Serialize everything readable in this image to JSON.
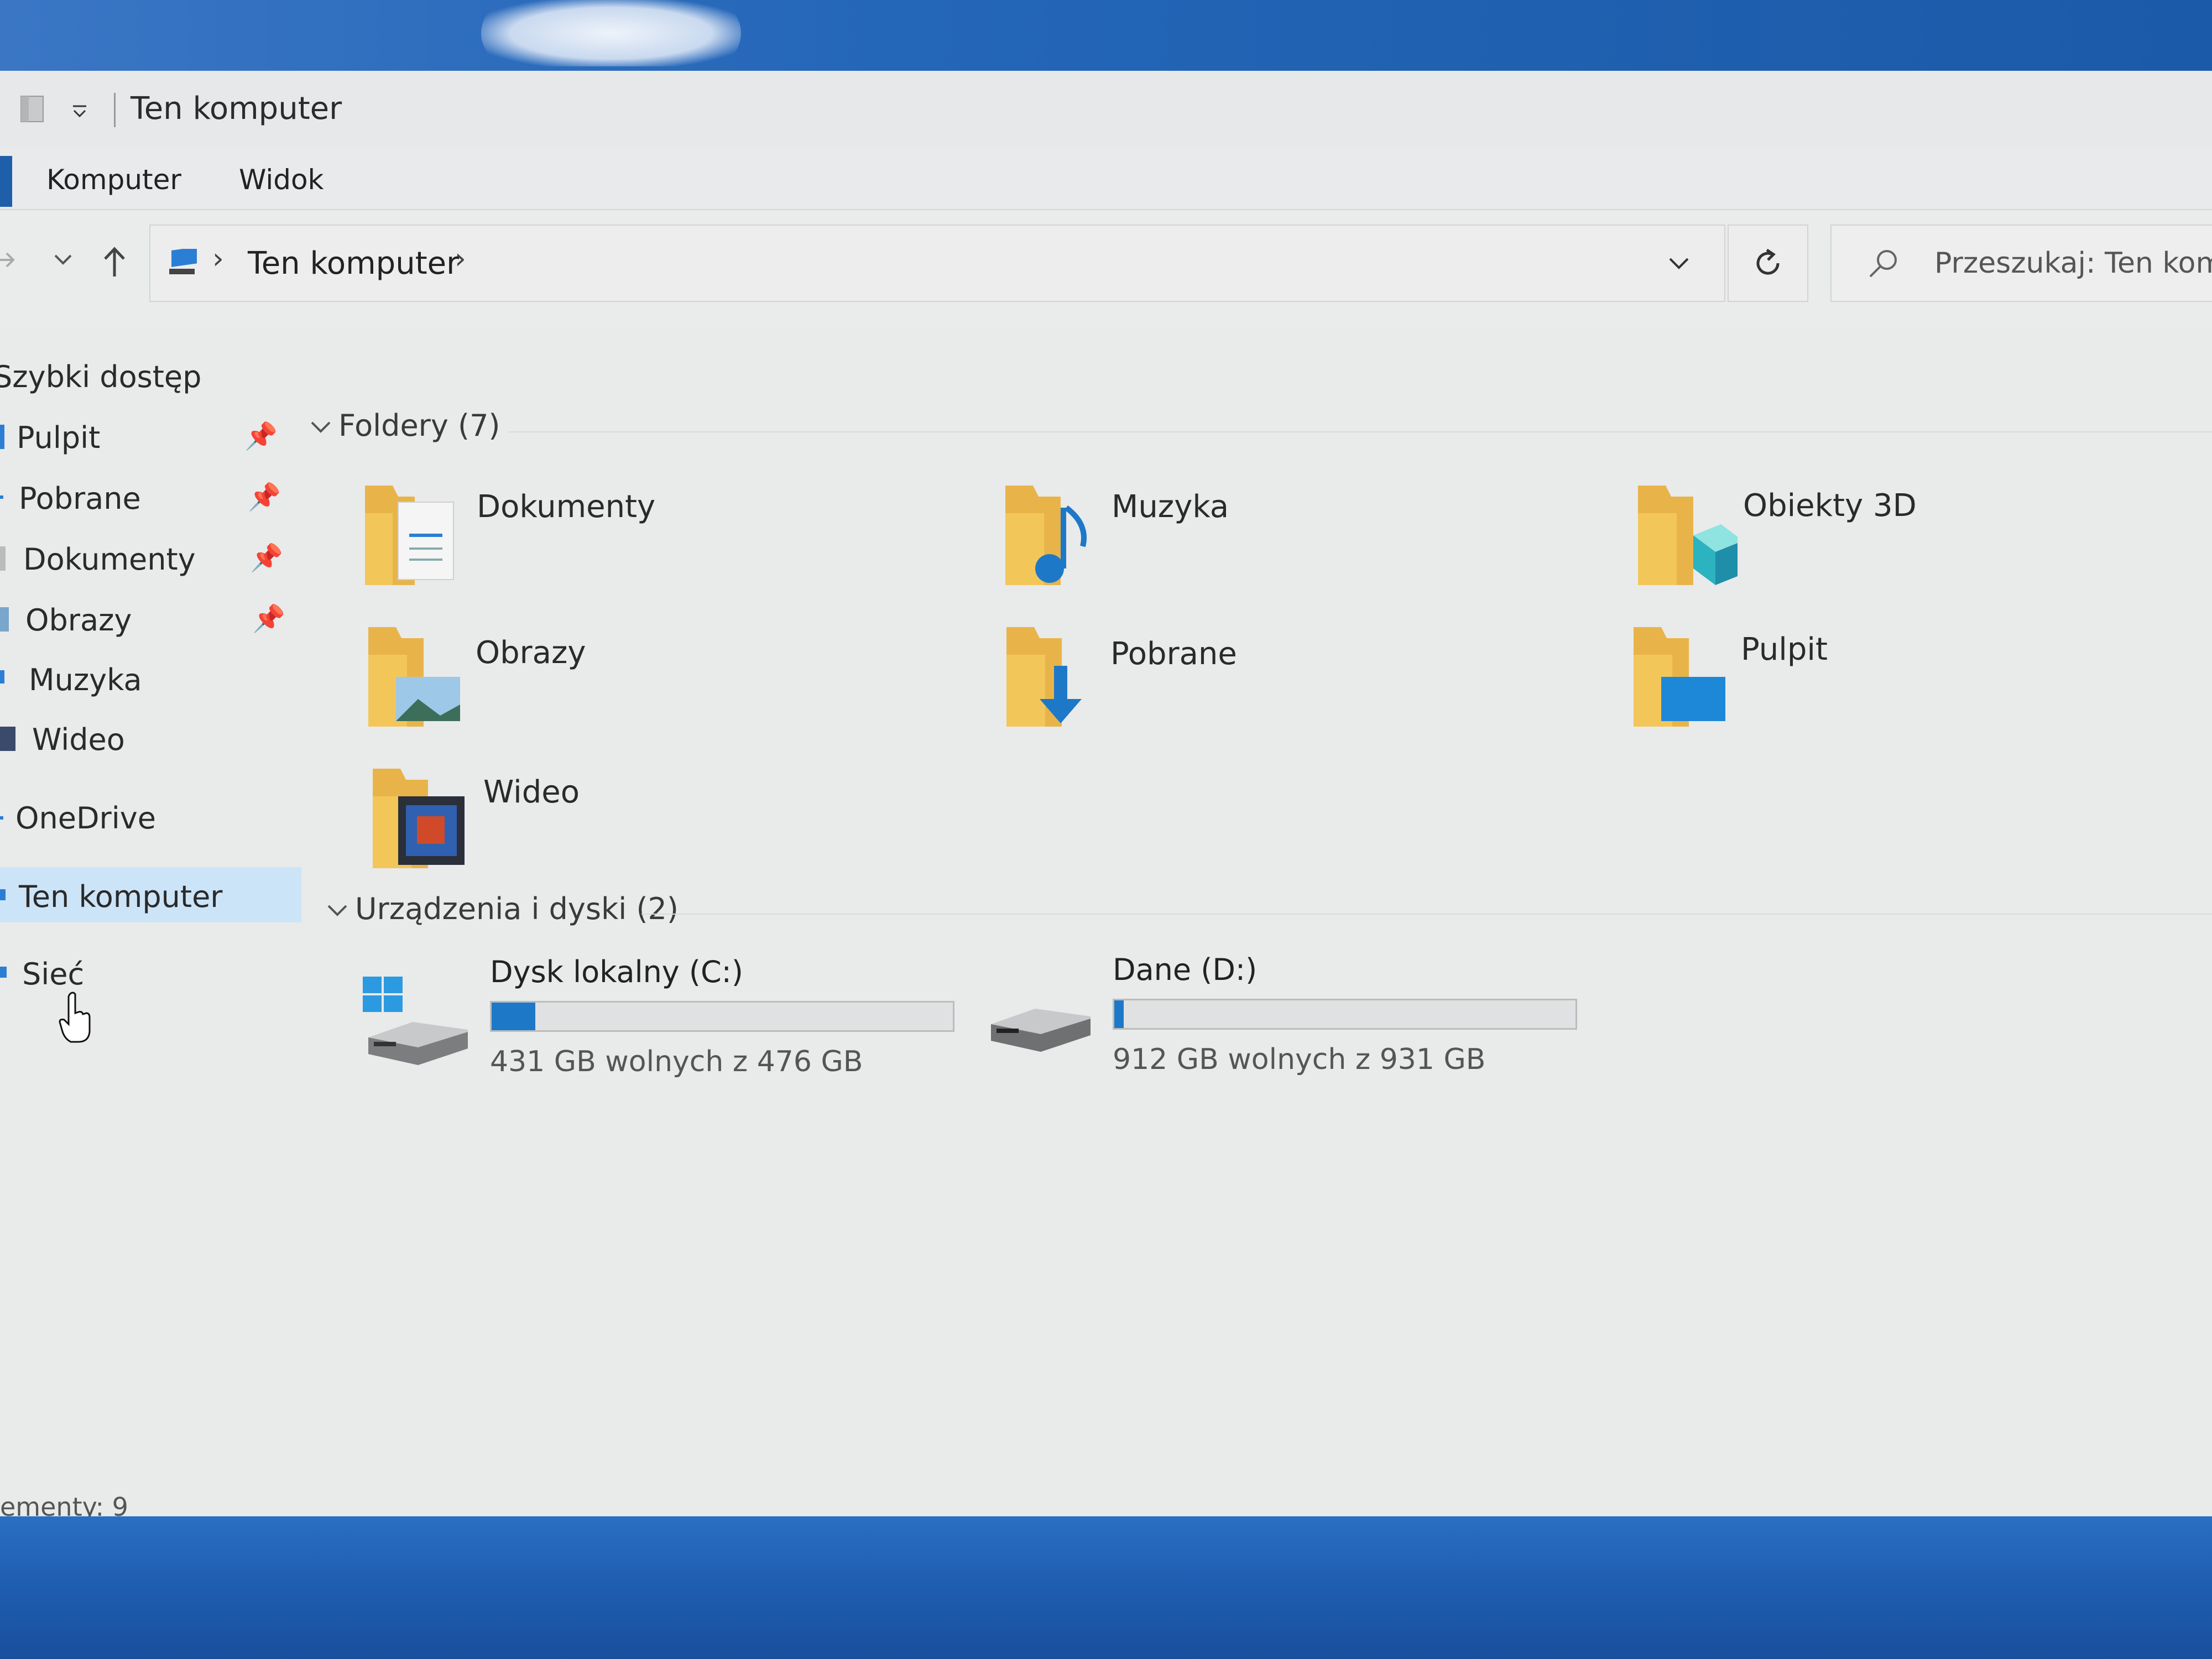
{
  "window": {
    "title": "Ten komputer"
  },
  "ribbon": {
    "tabs": [
      {
        "label": "Komputer"
      },
      {
        "label": "Widok"
      }
    ]
  },
  "navigation": {
    "address_path": "Ten komputer",
    "search_placeholder": "Przeszukaj: Ten komp"
  },
  "sidebar": {
    "items": [
      {
        "label": "Szybki dostęp",
        "pinned": false
      },
      {
        "label": "Pulpit",
        "pinned": true
      },
      {
        "label": "Pobrane",
        "pinned": true
      },
      {
        "label": "Dokumenty",
        "pinned": true
      },
      {
        "label": "Obrazy",
        "pinned": true
      },
      {
        "label": "Muzyka",
        "pinned": false
      },
      {
        "label": "Wideo",
        "pinned": false
      },
      {
        "label": "OneDrive",
        "pinned": false
      },
      {
        "label": "Ten komputer",
        "pinned": false,
        "selected": true
      },
      {
        "label": "Sieć",
        "pinned": false
      }
    ]
  },
  "folders": {
    "header": "Foldery (7)",
    "items": [
      {
        "label": "Dokumenty",
        "icon": "documents-folder-icon"
      },
      {
        "label": "Muzyka",
        "icon": "music-folder-icon"
      },
      {
        "label": "Obiekty 3D",
        "icon": "3d-objects-folder-icon"
      },
      {
        "label": "Obrazy",
        "icon": "pictures-folder-icon"
      },
      {
        "label": "Pobrane",
        "icon": "downloads-folder-icon"
      },
      {
        "label": "Pulpit",
        "icon": "desktop-folder-icon"
      },
      {
        "label": "Wideo",
        "icon": "videos-folder-icon"
      }
    ]
  },
  "devices": {
    "header": "Urządzenia i dyski (2)",
    "items": [
      {
        "name": "Dysk lokalny (C:)",
        "free_text": "431 GB wolnych z 476 GB",
        "used_fraction": 0.095,
        "icon": "system-drive-icon"
      },
      {
        "name": "Dane (D:)",
        "free_text": "912 GB wolnych z 931 GB",
        "used_fraction": 0.02,
        "icon": "drive-icon"
      }
    ]
  },
  "status": {
    "items_text": "ementy: 9"
  },
  "colors": {
    "accent": "#1e78c8",
    "selection": "#cce4f7",
    "folder": "#f3c65a",
    "desktop": "#1f5fb0"
  }
}
